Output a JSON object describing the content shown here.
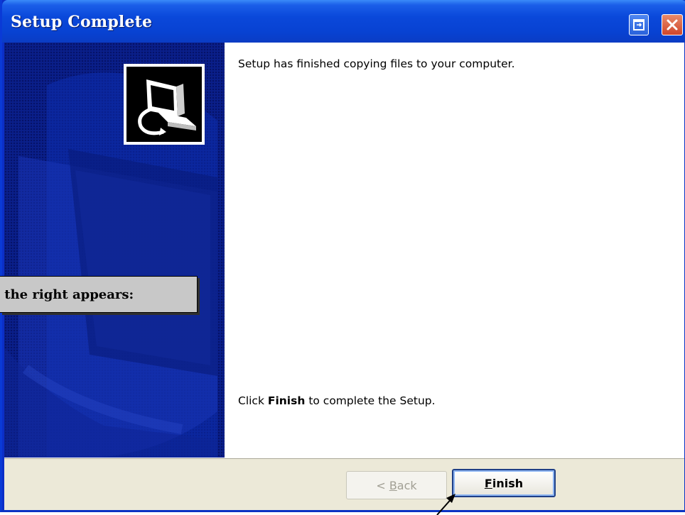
{
  "window": {
    "title": "Setup Complete"
  },
  "main": {
    "message_top": "Setup has finished copying files to your computer.",
    "message_bottom_prefix": "Click ",
    "message_bottom_bold": "Finish",
    "message_bottom_suffix": " to complete the Setup."
  },
  "buttons": {
    "back_prefix": "< ",
    "back_accel": "B",
    "back_rest": "ack",
    "back_enabled": false,
    "finish_accel": "F",
    "finish_rest": "inish"
  },
  "callout": {
    "text": "o the right appears:"
  },
  "icons": {
    "title_restore": "restore-icon",
    "title_close": "close-icon",
    "setup": "computer-setup-icon",
    "pointer": "arrow-pointer"
  },
  "colors": {
    "titlebar": "#0a48da",
    "side_panel": "#0a1f8a",
    "button_bar": "#ece9d8",
    "close_button": "#d0462a",
    "callout_bg": "#c8c8c8"
  }
}
